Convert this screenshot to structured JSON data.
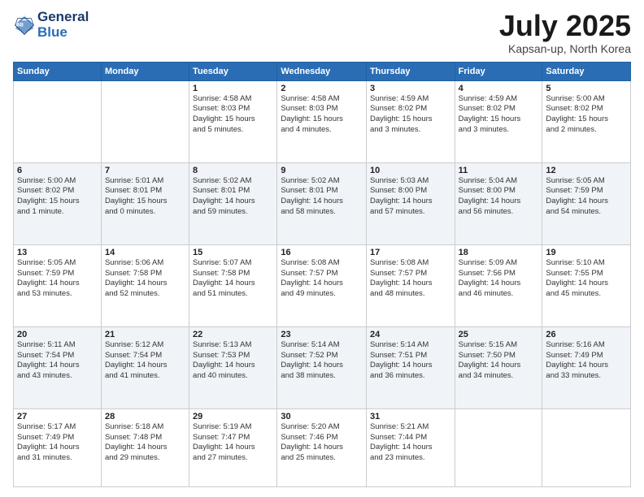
{
  "logo": {
    "line1": "General",
    "line2": "Blue"
  },
  "title": "July 2025",
  "location": "Kapsan-up, North Korea",
  "weekdays": [
    "Sunday",
    "Monday",
    "Tuesday",
    "Wednesday",
    "Thursday",
    "Friday",
    "Saturday"
  ],
  "weeks": [
    [
      {
        "day": "",
        "info": ""
      },
      {
        "day": "",
        "info": ""
      },
      {
        "day": "1",
        "info": "Sunrise: 4:58 AM\nSunset: 8:03 PM\nDaylight: 15 hours\nand 5 minutes."
      },
      {
        "day": "2",
        "info": "Sunrise: 4:58 AM\nSunset: 8:03 PM\nDaylight: 15 hours\nand 4 minutes."
      },
      {
        "day": "3",
        "info": "Sunrise: 4:59 AM\nSunset: 8:02 PM\nDaylight: 15 hours\nand 3 minutes."
      },
      {
        "day": "4",
        "info": "Sunrise: 4:59 AM\nSunset: 8:02 PM\nDaylight: 15 hours\nand 3 minutes."
      },
      {
        "day": "5",
        "info": "Sunrise: 5:00 AM\nSunset: 8:02 PM\nDaylight: 15 hours\nand 2 minutes."
      }
    ],
    [
      {
        "day": "6",
        "info": "Sunrise: 5:00 AM\nSunset: 8:02 PM\nDaylight: 15 hours\nand 1 minute."
      },
      {
        "day": "7",
        "info": "Sunrise: 5:01 AM\nSunset: 8:01 PM\nDaylight: 15 hours\nand 0 minutes."
      },
      {
        "day": "8",
        "info": "Sunrise: 5:02 AM\nSunset: 8:01 PM\nDaylight: 14 hours\nand 59 minutes."
      },
      {
        "day": "9",
        "info": "Sunrise: 5:02 AM\nSunset: 8:01 PM\nDaylight: 14 hours\nand 58 minutes."
      },
      {
        "day": "10",
        "info": "Sunrise: 5:03 AM\nSunset: 8:00 PM\nDaylight: 14 hours\nand 57 minutes."
      },
      {
        "day": "11",
        "info": "Sunrise: 5:04 AM\nSunset: 8:00 PM\nDaylight: 14 hours\nand 56 minutes."
      },
      {
        "day": "12",
        "info": "Sunrise: 5:05 AM\nSunset: 7:59 PM\nDaylight: 14 hours\nand 54 minutes."
      }
    ],
    [
      {
        "day": "13",
        "info": "Sunrise: 5:05 AM\nSunset: 7:59 PM\nDaylight: 14 hours\nand 53 minutes."
      },
      {
        "day": "14",
        "info": "Sunrise: 5:06 AM\nSunset: 7:58 PM\nDaylight: 14 hours\nand 52 minutes."
      },
      {
        "day": "15",
        "info": "Sunrise: 5:07 AM\nSunset: 7:58 PM\nDaylight: 14 hours\nand 51 minutes."
      },
      {
        "day": "16",
        "info": "Sunrise: 5:08 AM\nSunset: 7:57 PM\nDaylight: 14 hours\nand 49 minutes."
      },
      {
        "day": "17",
        "info": "Sunrise: 5:08 AM\nSunset: 7:57 PM\nDaylight: 14 hours\nand 48 minutes."
      },
      {
        "day": "18",
        "info": "Sunrise: 5:09 AM\nSunset: 7:56 PM\nDaylight: 14 hours\nand 46 minutes."
      },
      {
        "day": "19",
        "info": "Sunrise: 5:10 AM\nSunset: 7:55 PM\nDaylight: 14 hours\nand 45 minutes."
      }
    ],
    [
      {
        "day": "20",
        "info": "Sunrise: 5:11 AM\nSunset: 7:54 PM\nDaylight: 14 hours\nand 43 minutes."
      },
      {
        "day": "21",
        "info": "Sunrise: 5:12 AM\nSunset: 7:54 PM\nDaylight: 14 hours\nand 41 minutes."
      },
      {
        "day": "22",
        "info": "Sunrise: 5:13 AM\nSunset: 7:53 PM\nDaylight: 14 hours\nand 40 minutes."
      },
      {
        "day": "23",
        "info": "Sunrise: 5:14 AM\nSunset: 7:52 PM\nDaylight: 14 hours\nand 38 minutes."
      },
      {
        "day": "24",
        "info": "Sunrise: 5:14 AM\nSunset: 7:51 PM\nDaylight: 14 hours\nand 36 minutes."
      },
      {
        "day": "25",
        "info": "Sunrise: 5:15 AM\nSunset: 7:50 PM\nDaylight: 14 hours\nand 34 minutes."
      },
      {
        "day": "26",
        "info": "Sunrise: 5:16 AM\nSunset: 7:49 PM\nDaylight: 14 hours\nand 33 minutes."
      }
    ],
    [
      {
        "day": "27",
        "info": "Sunrise: 5:17 AM\nSunset: 7:49 PM\nDaylight: 14 hours\nand 31 minutes."
      },
      {
        "day": "28",
        "info": "Sunrise: 5:18 AM\nSunset: 7:48 PM\nDaylight: 14 hours\nand 29 minutes."
      },
      {
        "day": "29",
        "info": "Sunrise: 5:19 AM\nSunset: 7:47 PM\nDaylight: 14 hours\nand 27 minutes."
      },
      {
        "day": "30",
        "info": "Sunrise: 5:20 AM\nSunset: 7:46 PM\nDaylight: 14 hours\nand 25 minutes."
      },
      {
        "day": "31",
        "info": "Sunrise: 5:21 AM\nSunset: 7:44 PM\nDaylight: 14 hours\nand 23 minutes."
      },
      {
        "day": "",
        "info": ""
      },
      {
        "day": "",
        "info": ""
      }
    ]
  ]
}
